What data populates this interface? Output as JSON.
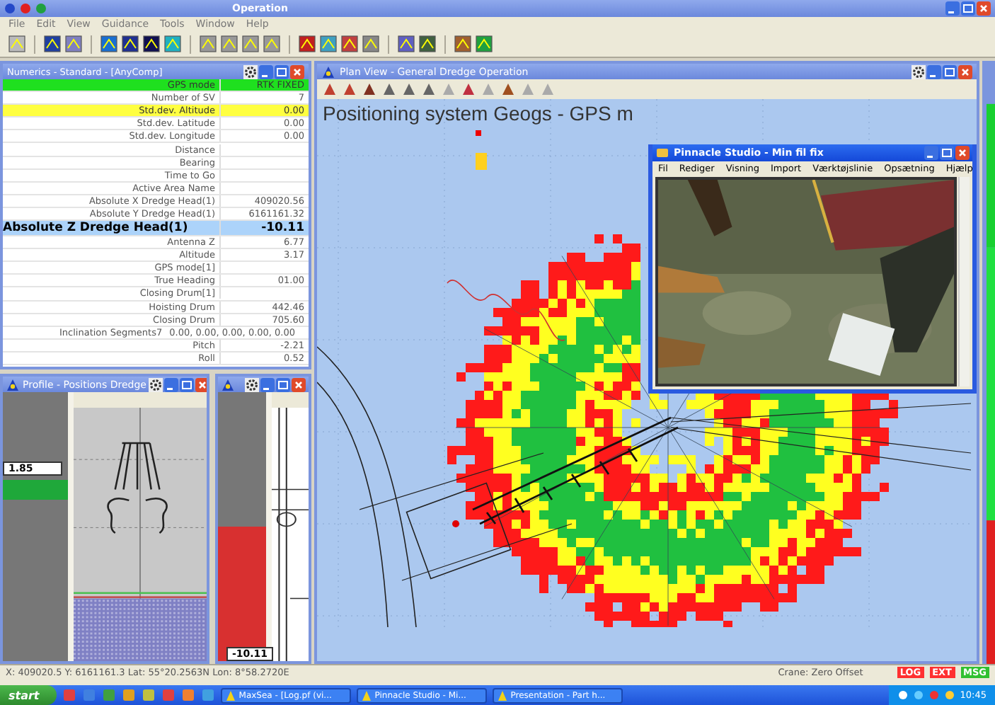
{
  "window": {
    "title": "Operation"
  },
  "menu": [
    "File",
    "Edit",
    "View",
    "Guidance",
    "Tools",
    "Window",
    "Help"
  ],
  "numerics": {
    "title": "Numerics - Standard - [AnyComp]",
    "rows": [
      {
        "label": "GPS mode",
        "value": "RTK FIXED",
        "kind": "good"
      },
      {
        "label": "Number of SV",
        "value": "7",
        "kind": "normal"
      },
      {
        "label": "Std.dev. Altitude",
        "value": "0.00",
        "kind": "warn"
      },
      {
        "label": "Std.dev. Latitude",
        "value": "0.00",
        "kind": "normal"
      },
      {
        "label": "Std.dev. Longitude",
        "value": "0.00",
        "kind": "normal"
      },
      {
        "label": "Distance",
        "kind": "normal"
      },
      {
        "label": "Bearing",
        "kind": "normal"
      },
      {
        "label": "Time to Go",
        "kind": "normal"
      },
      {
        "label": "Active Area Name",
        "kind": "normal"
      },
      {
        "label": "Absolute X Dredge Head(1)",
        "value": "409020.56",
        "kind": "normal"
      },
      {
        "label": "Absolute Y Dredge Head(1)",
        "value": "6161161.32",
        "kind": "normal"
      },
      {
        "label": "Absolute Z Dredge Head(1)",
        "value": "-10.11",
        "kind": "focus"
      },
      {
        "label": "Antenna Z",
        "value": "6.77",
        "kind": "normal"
      },
      {
        "label": "Altitude",
        "value": "3.17",
        "kind": "normal"
      },
      {
        "label": "GPS mode[1]",
        "kind": "normal"
      },
      {
        "label": "True Heading",
        "value": "01.00",
        "kind": "normal"
      },
      {
        "label": "Closing Drum[1]",
        "kind": "normal"
      },
      {
        "label": "Hoisting Drum",
        "value": "442.46",
        "kind": "normal"
      },
      {
        "label": "Closing Drum",
        "value": "705.60",
        "kind": "normal"
      },
      {
        "label": "Inclination Segments7",
        "value": "0.00, 0.00, 0.00, 0.00, 0.00",
        "kind": "wide"
      },
      {
        "label": "Pitch",
        "value": "-2.21",
        "kind": "normal"
      },
      {
        "label": "Roll",
        "value": "0.52",
        "kind": "normal"
      }
    ]
  },
  "profile": {
    "title": "Profile - Positions Dredge",
    "reading": "1.85"
  },
  "depth_gauge": {
    "reading": "-10.11",
    "level": 0.5
  },
  "plan_view": {
    "title": "Plan View - General Dredge Operation",
    "heading": "Positioning system Geogs - GPS m"
  },
  "video_window": {
    "title": "Pinnacle Studio - Min fil fix",
    "menu": [
      "Fil",
      "Rediger",
      "Visning",
      "Import",
      "Værktøjslinie",
      "Opsætning",
      "Hjælp"
    ]
  },
  "status_bar": {
    "position": "X: 409020.5 Y: 6161161.3 Lat: 55°20.2563N Lon: 8°58.2720E",
    "crane": "Crane: Zero Offset",
    "indicators": [
      {
        "label": "LOG",
        "color": "#ff3030"
      },
      {
        "label": "EXT",
        "color": "#ff3030"
      },
      {
        "label": "MSG",
        "color": "#30c030"
      }
    ]
  },
  "taskbar": {
    "start": "start",
    "tasks": [
      "MaxSea - [Log.pf (vi...",
      "Pinnacle Studio - Mi...",
      "Presentation - Part h..."
    ],
    "clock": "10:45"
  }
}
